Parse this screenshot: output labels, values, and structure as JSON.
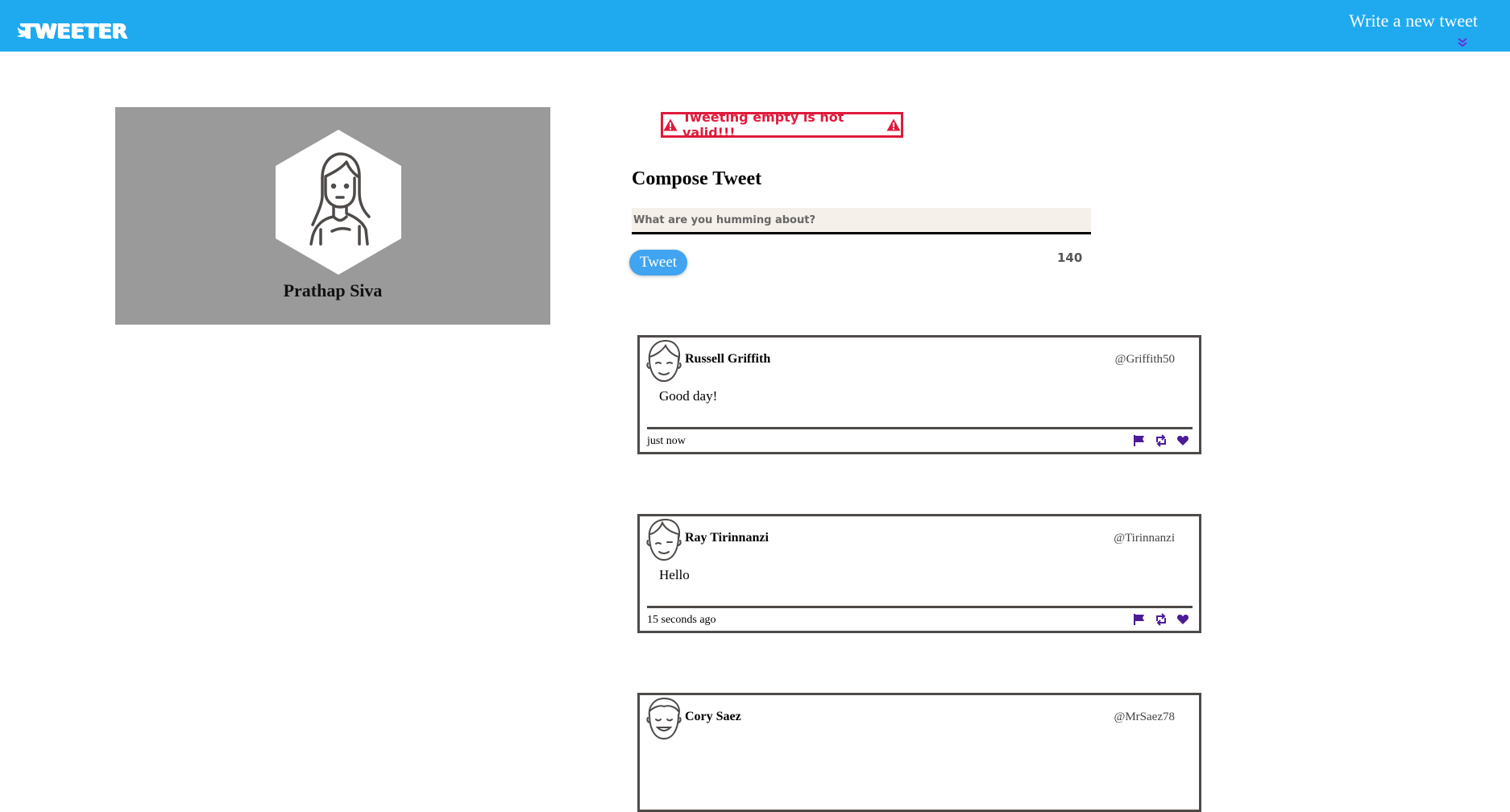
{
  "nav": {
    "brand": "TWEETER",
    "write_new_tweet": "Write a new tweet"
  },
  "profile": {
    "name": "Prathap Siva"
  },
  "error": {
    "message": "Tweeting empty is not valid!!!"
  },
  "compose": {
    "title": "Compose Tweet",
    "placeholder": "What are you humming about?",
    "value": "",
    "button_label": "Tweet",
    "counter": "140"
  },
  "tweets": [
    {
      "name": "Russell Griffith",
      "handle": "@Griffith50",
      "text": "Good day!",
      "time": "just now"
    },
    {
      "name": "Ray Tirinnanzi",
      "handle": "@Tirinnanzi",
      "text": "Hello",
      "time": "15 seconds ago"
    },
    {
      "name": "Cory Saez",
      "handle": "@MrSaez78",
      "text": "",
      "time": ""
    }
  ],
  "colors": {
    "nav_bg": "#1faaf0",
    "error": "#e01a3b",
    "action_icons": "#4b1c96",
    "tweet_button": "#40a4f0"
  },
  "icons": [
    "bird-icon",
    "double-chevron-down-icon",
    "warning-icon",
    "flag-icon",
    "retweet-icon",
    "heart-icon"
  ]
}
